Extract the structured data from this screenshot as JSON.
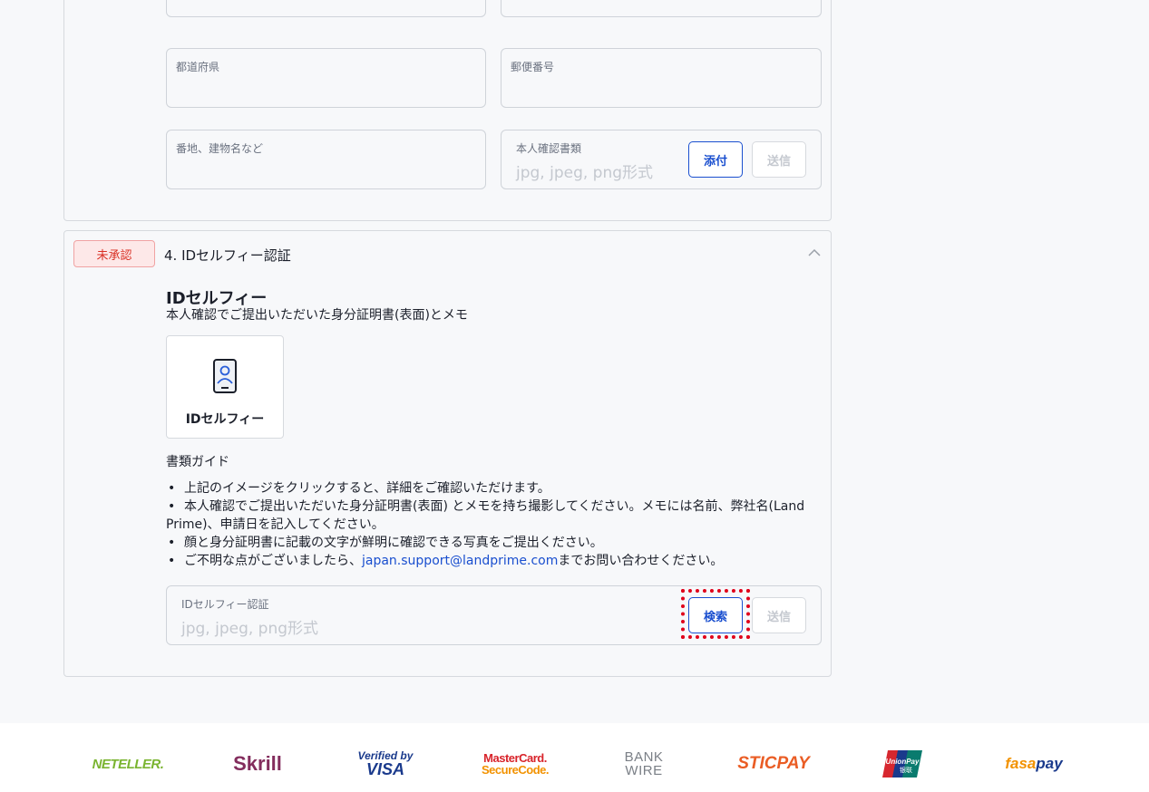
{
  "address_section": {
    "prefecture_label": "都道府県",
    "postal_code_label": "郵便番号",
    "street_label": "番地、建物名など",
    "id_document": {
      "label": "本人確認書類",
      "placeholder": "jpg, jpeg, png形式",
      "attach_label": "添付",
      "send_label": "送信"
    }
  },
  "selfie_section": {
    "status_badge": "未承認",
    "title": "4. IDセルフィー認証",
    "heading": "IDセルフィー",
    "subheading": "本人確認でご提出いただいた身分証明書(表面)とメモ",
    "tile_label": "IDセルフィー",
    "guide_title": "書類ガイド",
    "guide_items": [
      "上記のイメージをクリックすると、詳細をご確認いただけます。",
      "本人確認でご提出いただいた身分証明書(表面) とメモを持ち撮影してください。メモには名前、弊社名(Land Prime)、申請日を記入してください。",
      "顔と身分証明書に記載の文字が鮮明に確認できる写真をご提出ください。"
    ],
    "contact_prefix": "ご不明な点がございましたら、",
    "contact_email": "japan.support@landprime.com",
    "contact_suffix": "までお問い合わせください。",
    "upload": {
      "label": "IDセルフィー認証",
      "placeholder": "jpg, jpeg, png形式",
      "browse_label": "検索",
      "send_label": "送信"
    }
  },
  "payment_logos": {
    "neteller": "NETELLER.",
    "skrill": "Skrill",
    "verified_by": "Verified by",
    "visa": "VISA",
    "mastercard": "MasterCard.",
    "securecode": "SecureCode.",
    "bank": "BANK",
    "wire": "WIRE",
    "sticpay": "STICPAY",
    "unionpay": "UnionPay",
    "unionpay_cn": "银联",
    "fasapay_fasa": "fasa",
    "fasapay_pay": "pay"
  },
  "colors": {
    "accent_blue": "#1a4fcf",
    "badge_red": "#d93025",
    "highlight_red": "#e0001a"
  }
}
